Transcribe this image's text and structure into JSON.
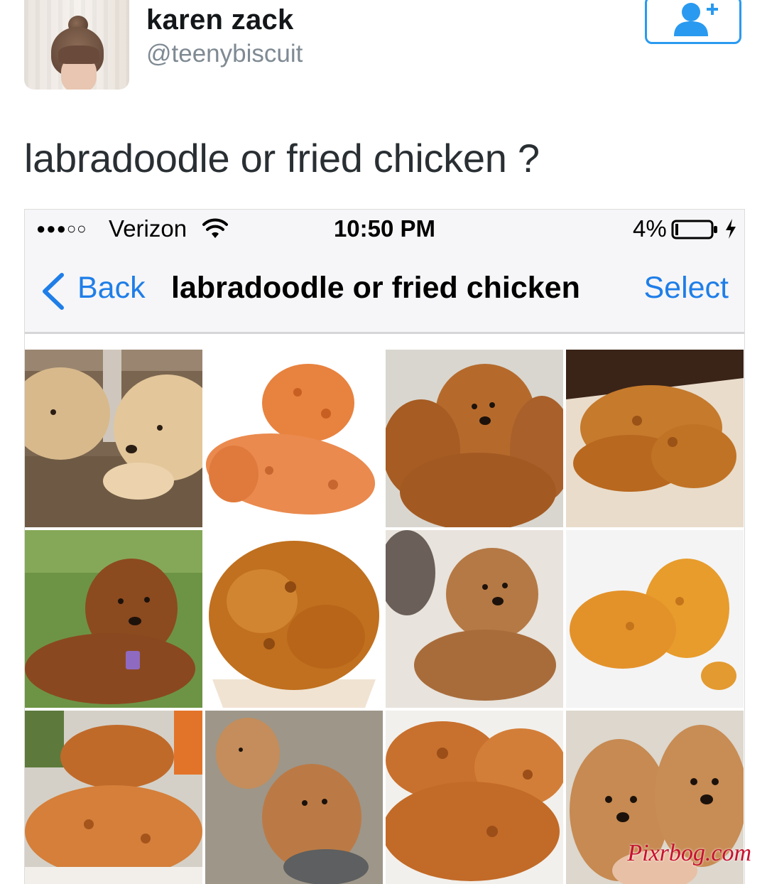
{
  "tweet": {
    "author_name": "karen zack",
    "author_handle": "@teenybiscuit",
    "text": "labradoodle or fried chicken ?",
    "follow_icon": "add-user-icon"
  },
  "phone_screenshot": {
    "status_bar": {
      "carrier": "Verizon",
      "signal": "●●●○○",
      "time": "10:50 PM",
      "battery": "4%",
      "icons": [
        "wifi-icon",
        "battery-icon",
        "charging-icon"
      ]
    },
    "nav_bar": {
      "back_label": "Back",
      "title": "labradoodle or fried chicken",
      "select_label": "Select"
    },
    "photos": [
      {
        "subject": "labradoodle"
      },
      {
        "subject": "fried chicken"
      },
      {
        "subject": "labradoodle"
      },
      {
        "subject": "fried chicken"
      },
      {
        "subject": "labradoodle"
      },
      {
        "subject": "fried chicken"
      },
      {
        "subject": "labradoodle"
      },
      {
        "subject": "fried chicken"
      },
      {
        "subject": "fried chicken"
      },
      {
        "subject": "labradoodle"
      },
      {
        "subject": "fried chicken"
      },
      {
        "subject": "labradoodle"
      }
    ]
  },
  "watermark": "Pixrbog.com",
  "colors": {
    "link_blue": "#1f7ee8",
    "follow_blue": "#2a9af0",
    "handle_gray": "#7f8a93",
    "watermark_red": "#c8102e"
  }
}
